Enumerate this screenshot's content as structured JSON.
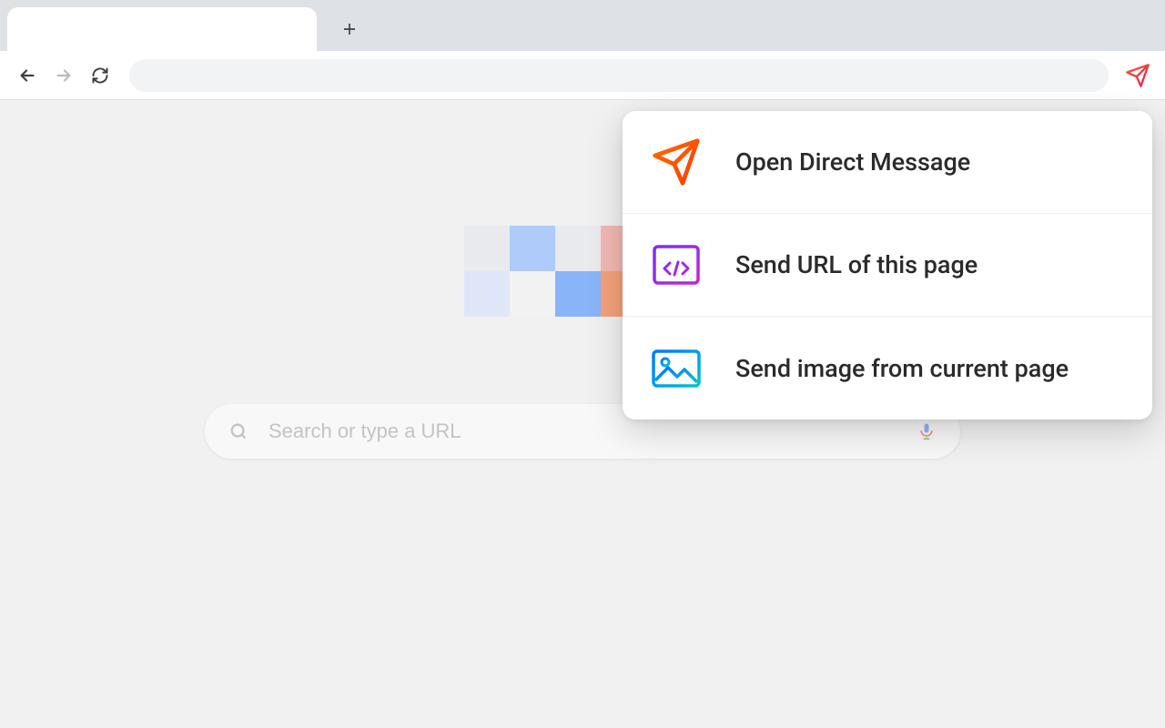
{
  "search": {
    "placeholder": "Search or type a URL"
  },
  "popup": {
    "items": [
      {
        "label": "Open Direct Message"
      },
      {
        "label": "Send URL of this page"
      },
      {
        "label": "Send image from current page"
      }
    ]
  }
}
